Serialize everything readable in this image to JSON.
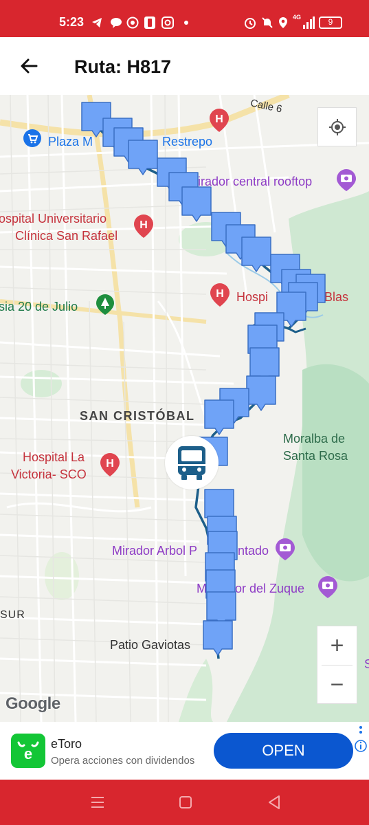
{
  "status_bar": {
    "time": "5:23",
    "battery": "9",
    "network": "4G",
    "icons": [
      "telegram-icon",
      "chat-icon",
      "whatsapp-icon",
      "battery-saver-icon",
      "instagram-icon",
      "dot-icon",
      "alarm-icon",
      "mute-icon",
      "location-icon",
      "signal-icon",
      "battery-icon"
    ],
    "color": "#d8262e"
  },
  "app_bar": {
    "title": "Ruta: H817",
    "back_icon": "arrow-left-icon"
  },
  "map": {
    "labels": {
      "calle_6": "Calle 6",
      "plaza": "Plaza M",
      "restrepo": "Restrepo",
      "mirador_central": "irador central rooftop",
      "hospital_universitario_1": "ospital Universitario",
      "hospital_universitario_2": "Clínica San Rafael",
      "hospital_san_blas_a": "Hospi",
      "hospital_san_blas_b": "Blas",
      "iglesia": "sia 20 de Julio",
      "san_cristobal": "SAN CRISTÓBAL",
      "moralba_1": "Moralba de",
      "moralba_2": "Santa Rosa",
      "hospital_victoria_1": "Hospital La",
      "hospital_victoria_2": "Victoria- SCO",
      "mirador_arbol_a": "Mirador Arbol P",
      "mirador_arbol_b": "ntado",
      "mirador_zuque_a": "M",
      "mirador_zuque_b": "or del Zuque",
      "sur": "SUR",
      "patio": "Patio Gaviotas",
      "edge_s": "S"
    },
    "route_color": "#1d5f8a",
    "marker_color": "#6fa3f7",
    "controls": {
      "zoom_in": "+",
      "zoom_out": "−",
      "my_location_icon": "my-location-icon"
    },
    "attribution": "Google"
  },
  "ad": {
    "title": "eToro",
    "subtitle": "Opera acciones con dividendos",
    "button": "OPEN",
    "logo_color": "#13c636"
  },
  "nav_bar": {
    "buttons": [
      "recent-apps-icon",
      "home-icon",
      "back-icon"
    ],
    "color": "#d8262e"
  }
}
